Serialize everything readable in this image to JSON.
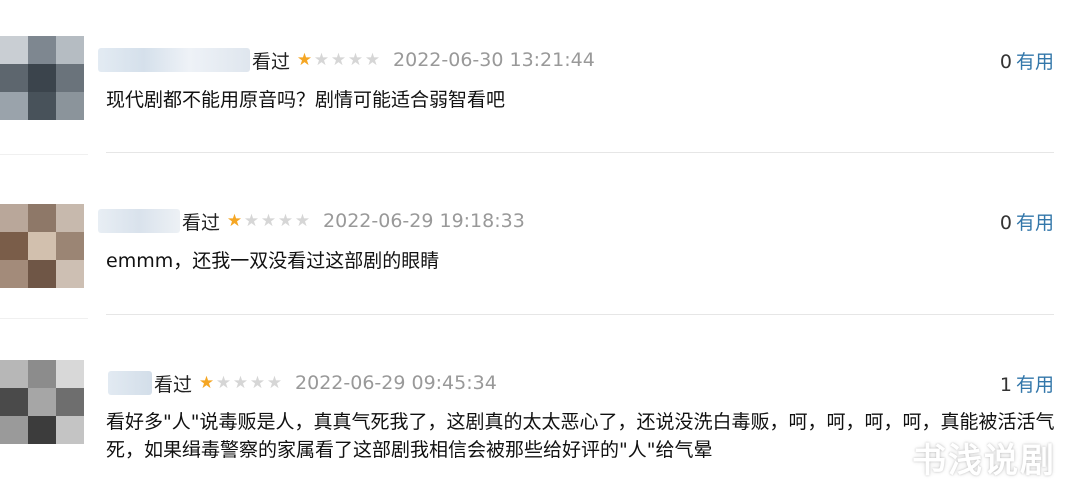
{
  "reviews": [
    {
      "watched": "看过",
      "rating": 1,
      "max_rating": 5,
      "time": "2022-06-30 13:21:44",
      "useful_count": "0",
      "useful_label": "有用",
      "text": "现代剧都不能用原音吗？剧情可能适合弱智看吧"
    },
    {
      "watched": "看过",
      "rating": 1,
      "max_rating": 5,
      "time": "2022-06-29 19:18:33",
      "useful_count": "0",
      "useful_label": "有用",
      "text": "emmm，还我一双没看过这部剧的眼睛"
    },
    {
      "watched": "看过",
      "rating": 1,
      "max_rating": 5,
      "time": "2022-06-29 09:45:34",
      "useful_count": "1",
      "useful_label": "有用",
      "text": "看好多\"人\"说毒贩是人，真真气死我了，这剧真的太太恶心了，还说没洗白毒贩，呵，呵，呵，呵，真能被活活气死，如果缉毒警察的家属看了这部剧我相信会被那些给好评的\"人\"给气晕"
    }
  ],
  "watermark": "书浅说剧",
  "colors": {
    "star_on": "#f5a623",
    "star_off": "#d6d6d6",
    "link": "#3377aa",
    "time": "#999999"
  }
}
